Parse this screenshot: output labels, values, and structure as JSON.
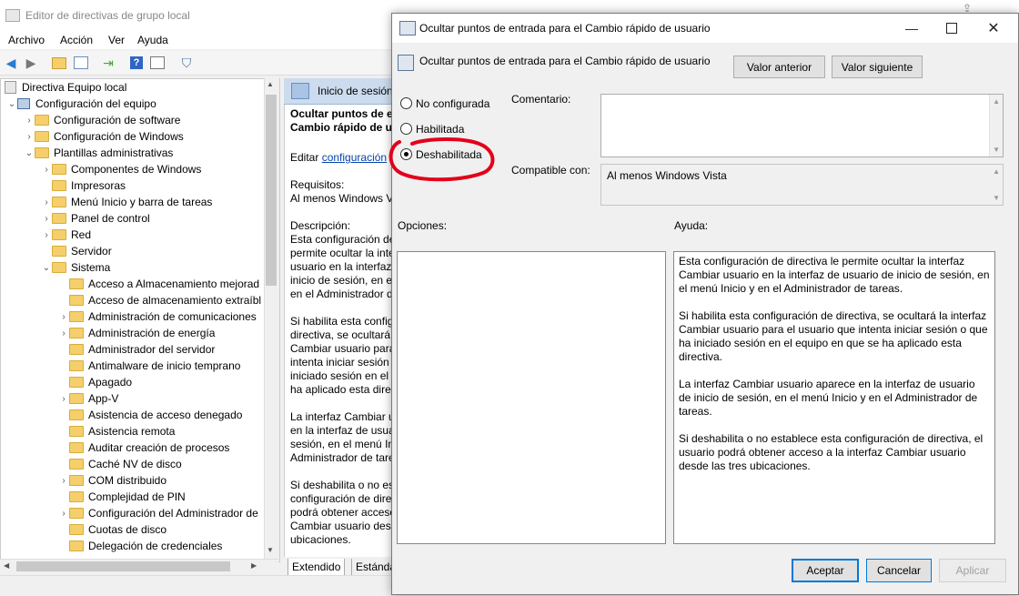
{
  "main_window": {
    "title": "Editor de directivas de grupo local",
    "menu": [
      "Archivo",
      "Acción",
      "Ver",
      "Ayuda"
    ],
    "toolbar_icons": [
      "back-arrow-icon",
      "forward-arrow-icon",
      "up-folder-icon",
      "show-hide-tree-icon",
      "export-list-icon",
      "help-icon",
      "properties-icon",
      "filter-icon"
    ],
    "tree": {
      "root": "Directiva Equipo local",
      "items": [
        {
          "label": "Configuración del equipo",
          "level": 1,
          "expanded": true,
          "icon": "computer-icon"
        },
        {
          "label": "Configuración de software",
          "level": 2,
          "expanded": false
        },
        {
          "label": "Configuración de Windows",
          "level": 2,
          "expanded": false
        },
        {
          "label": "Plantillas administrativas",
          "level": 2,
          "expanded": true
        },
        {
          "label": "Componentes de Windows",
          "level": 3,
          "expanded": false
        },
        {
          "label": "Impresoras",
          "level": 3,
          "expanded": null
        },
        {
          "label": "Menú Inicio y barra de tareas",
          "level": 3,
          "expanded": false
        },
        {
          "label": "Panel de control",
          "level": 3,
          "expanded": false
        },
        {
          "label": "Red",
          "level": 3,
          "expanded": false
        },
        {
          "label": "Servidor",
          "level": 3,
          "expanded": null
        },
        {
          "label": "Sistema",
          "level": 3,
          "expanded": true
        },
        {
          "label": "Acceso a Almacenamiento mejorad",
          "level": 4,
          "expanded": null
        },
        {
          "label": "Acceso de almacenamiento extraíbl",
          "level": 4,
          "expanded": null
        },
        {
          "label": "Administración de comunicaciones",
          "level": 4,
          "expanded": false
        },
        {
          "label": "Administración de energía",
          "level": 4,
          "expanded": false
        },
        {
          "label": "Administrador del servidor",
          "level": 4,
          "expanded": null
        },
        {
          "label": "Antimalware de inicio temprano",
          "level": 4,
          "expanded": null
        },
        {
          "label": "Apagado",
          "level": 4,
          "expanded": null
        },
        {
          "label": "App-V",
          "level": 4,
          "expanded": false
        },
        {
          "label": "Asistencia de acceso denegado",
          "level": 4,
          "expanded": null
        },
        {
          "label": "Asistencia remota",
          "level": 4,
          "expanded": null
        },
        {
          "label": "Auditar creación de procesos",
          "level": 4,
          "expanded": null
        },
        {
          "label": "Caché NV de disco",
          "level": 4,
          "expanded": null
        },
        {
          "label": "COM distribuido",
          "level": 4,
          "expanded": false
        },
        {
          "label": "Complejidad de PIN",
          "level": 4,
          "expanded": null
        },
        {
          "label": "Configuración del Administrador de",
          "level": 4,
          "expanded": false
        },
        {
          "label": "Cuotas de disco",
          "level": 4,
          "expanded": null
        },
        {
          "label": "Delegación de credenciales",
          "level": 4,
          "expanded": null
        }
      ]
    },
    "description_pane": {
      "header": "Inicio de sesión",
      "title_line1": "Ocultar puntos de en",
      "title_line2": "Cambio rápido de us",
      "edit_prefix": "Editar",
      "edit_link": "configuración",
      "requirements_label": "Requisitos:",
      "requirements_value": "Al menos Windows Vi",
      "description_label": "Descripción:",
      "description_lines": [
        "Esta configuración de",
        "permite ocultar la inte",
        "usuario en la interfaz",
        "inicio de sesión, en el",
        "en el Administrador d",
        "",
        "Si habilita esta config",
        "directiva, se ocultará",
        "Cambiar usuario para",
        "intenta iniciar sesión",
        "iniciado sesión en el e",
        "ha aplicado esta direc",
        "",
        "La interfaz Cambiar u",
        "en la interfaz de usua",
        "sesión, en el menú In",
        "Administrador de tare",
        "",
        "Si deshabilita o no est",
        "configuración de direc",
        "podrá obtener acceso",
        "Cambiar usuario desc",
        "ubicaciones."
      ],
      "tabs": [
        "Extendido",
        "Estánda"
      ]
    }
  },
  "dialog": {
    "title": "Ocultar puntos de entrada para el Cambio rápido de usuario",
    "heading": "Ocultar puntos de entrada para el Cambio rápido de usuario",
    "prev_button": "Valor anterior",
    "next_button": "Valor siguiente",
    "radios": [
      {
        "label": "No configurada",
        "checked": false
      },
      {
        "label": "Habilitada",
        "checked": false
      },
      {
        "label": "Deshabilitada",
        "checked": true
      }
    ],
    "comment_label": "Comentario:",
    "comment_value": "",
    "supported_label": "Compatible con:",
    "supported_value": "Al menos Windows Vista",
    "options_label": "Opciones:",
    "help_label": "Ayuda:",
    "help_paragraphs": [
      "Esta configuración de directiva le permite ocultar la interfaz Cambiar usuario en la interfaz de usuario de inicio de sesión, en el menú Inicio y en el Administrador de tareas.",
      "Si habilita esta configuración de directiva, se ocultará la interfaz Cambiar usuario para el usuario que intenta iniciar sesión o que ha iniciado sesión en el equipo en que se ha aplicado esta directiva.",
      "La interfaz Cambiar usuario aparece en la interfaz de usuario de inicio de sesión, en el menú Inicio y en el Administrador de tareas.",
      "Si deshabilita o no establece esta configuración de directiva, el usuario podrá obtener acceso a la interfaz Cambiar usuario desde las tres ubicaciones."
    ],
    "ok_button": "Aceptar",
    "cancel_button": "Cancelar",
    "apply_button": "Aplicar",
    "annotation_color": "#e3001b"
  }
}
